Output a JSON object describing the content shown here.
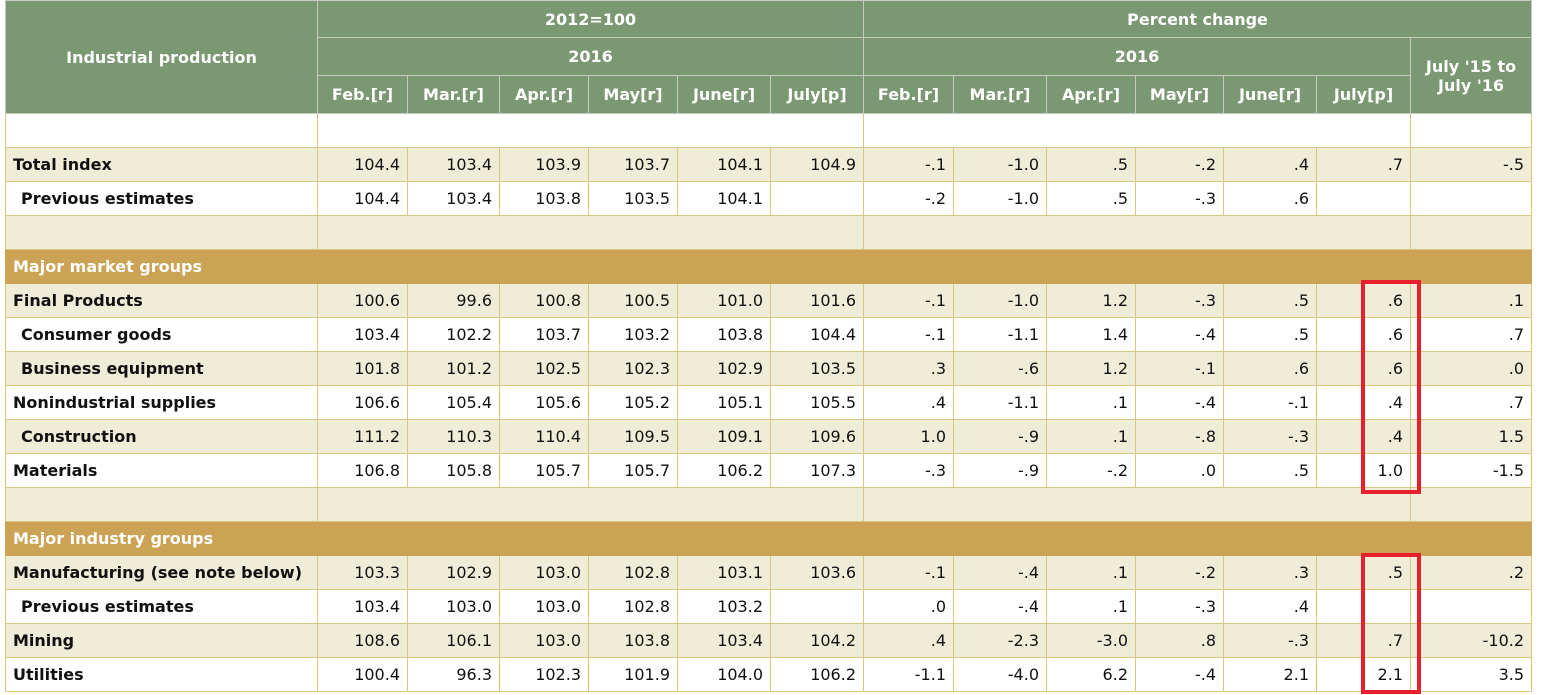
{
  "header": {
    "title": "Industrial production",
    "group_index": "2012=100",
    "group_pct": "Percent change",
    "year_index": "2016",
    "year_pct": "2016",
    "yoy": "July '15 to July '16",
    "months": [
      "Feb.[r]",
      "Mar.[r]",
      "Apr.[r]",
      "May[r]",
      "June[r]",
      "July[p]"
    ]
  },
  "rows": [
    {
      "type": "blank",
      "style": "white"
    },
    {
      "type": "data",
      "style": "beige",
      "label": "Total index",
      "indent": false,
      "index": [
        "104.4",
        "103.4",
        "103.9",
        "103.7",
        "104.1",
        "104.9"
      ],
      "pct": [
        "-.1",
        "-1.0",
        ".5",
        "-.2",
        ".4",
        ".7"
      ],
      "yoy": "-.5"
    },
    {
      "type": "data",
      "style": "white",
      "label": "Previous estimates",
      "indent": true,
      "index": [
        "104.4",
        "103.4",
        "103.8",
        "103.5",
        "104.1",
        ""
      ],
      "pct": [
        "-.2",
        "-1.0",
        ".5",
        "-.3",
        ".6",
        ""
      ],
      "yoy": ""
    },
    {
      "type": "blank",
      "style": "beige"
    },
    {
      "type": "section",
      "label": "Major market groups"
    },
    {
      "type": "data",
      "style": "beige",
      "label": "Final Products",
      "indent": false,
      "index": [
        "100.6",
        "99.6",
        "100.8",
        "100.5",
        "101.0",
        "101.6"
      ],
      "pct": [
        "-.1",
        "-1.0",
        "1.2",
        "-.3",
        ".5",
        ".6"
      ],
      "yoy": ".1"
    },
    {
      "type": "data",
      "style": "white",
      "label": "Consumer goods",
      "indent": true,
      "index": [
        "103.4",
        "102.2",
        "103.7",
        "103.2",
        "103.8",
        "104.4"
      ],
      "pct": [
        "-.1",
        "-1.1",
        "1.4",
        "-.4",
        ".5",
        ".6"
      ],
      "yoy": ".7"
    },
    {
      "type": "data",
      "style": "beige",
      "label": "Business equipment",
      "indent": true,
      "index": [
        "101.8",
        "101.2",
        "102.5",
        "102.3",
        "102.9",
        "103.5"
      ],
      "pct": [
        ".3",
        "-.6",
        "1.2",
        "-.1",
        ".6",
        ".6"
      ],
      "yoy": ".0"
    },
    {
      "type": "data",
      "style": "white",
      "label": "Nonindustrial supplies",
      "indent": false,
      "index": [
        "106.6",
        "105.4",
        "105.6",
        "105.2",
        "105.1",
        "105.5"
      ],
      "pct": [
        ".4",
        "-1.1",
        ".1",
        "-.4",
        "-.1",
        ".4"
      ],
      "yoy": ".7"
    },
    {
      "type": "data",
      "style": "beige",
      "label": "Construction",
      "indent": true,
      "index": [
        "111.2",
        "110.3",
        "110.4",
        "109.5",
        "109.1",
        "109.6"
      ],
      "pct": [
        "1.0",
        "-.9",
        ".1",
        "-.8",
        "-.3",
        ".4"
      ],
      "yoy": "1.5"
    },
    {
      "type": "data",
      "style": "white",
      "label": "Materials",
      "indent": false,
      "index": [
        "106.8",
        "105.8",
        "105.7",
        "105.7",
        "106.2",
        "107.3"
      ],
      "pct": [
        "-.3",
        "-.9",
        "-.2",
        ".0",
        ".5",
        "1.0"
      ],
      "yoy": "-1.5"
    },
    {
      "type": "blank",
      "style": "beige"
    },
    {
      "type": "section",
      "label": "Major industry groups"
    },
    {
      "type": "data",
      "style": "beige",
      "label": "Manufacturing (see note below)",
      "indent": false,
      "index": [
        "103.3",
        "102.9",
        "103.0",
        "102.8",
        "103.1",
        "103.6"
      ],
      "pct": [
        "-.1",
        "-.4",
        ".1",
        "-.2",
        ".3",
        ".5"
      ],
      "yoy": ".2"
    },
    {
      "type": "data",
      "style": "white",
      "label": "Previous estimates",
      "indent": true,
      "index": [
        "103.4",
        "103.0",
        "103.0",
        "102.8",
        "103.2",
        ""
      ],
      "pct": [
        ".0",
        "-.4",
        ".1",
        "-.3",
        ".4",
        ""
      ],
      "yoy": ""
    },
    {
      "type": "data",
      "style": "beige",
      "label": "Mining",
      "indent": false,
      "index": [
        "108.6",
        "106.1",
        "103.0",
        "103.8",
        "103.4",
        "104.2"
      ],
      "pct": [
        ".4",
        "-2.3",
        "-3.0",
        ".8",
        "-.3",
        ".7"
      ],
      "yoy": "-10.2"
    },
    {
      "type": "data",
      "style": "white",
      "label": "Utilities",
      "indent": false,
      "index": [
        "100.4",
        "96.3",
        "102.3",
        "101.9",
        "104.0",
        "106.2"
      ],
      "pct": [
        "-1.1",
        "-4.0",
        "6.2",
        "-.4",
        "2.1",
        "2.1"
      ],
      "yoy": "3.5"
    }
  ]
}
